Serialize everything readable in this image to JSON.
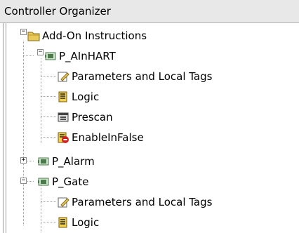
{
  "window": {
    "title": "Controller Organizer"
  },
  "tree": {
    "root": {
      "label": "Add-On Instructions",
      "icon": "folder-icon",
      "expanded": true
    },
    "nodes": [
      {
        "label": "P_AInHART",
        "icon": "add-on-instruction-icon",
        "expanded": true,
        "children": [
          {
            "label": "Parameters and Local Tags",
            "icon": "parameters-icon"
          },
          {
            "label": "Logic",
            "icon": "logic-routine-icon"
          },
          {
            "label": "Prescan",
            "icon": "prescan-routine-icon"
          },
          {
            "label": "EnableInFalse",
            "icon": "enable-in-false-icon"
          }
        ]
      },
      {
        "label": "P_Alarm",
        "icon": "add-on-instruction-icon",
        "expanded": false,
        "children": []
      },
      {
        "label": "P_Gate",
        "icon": "add-on-instruction-icon",
        "expanded": true,
        "children": [
          {
            "label": "Parameters and Local Tags",
            "icon": "parameters-icon"
          },
          {
            "label": "Logic",
            "icon": "logic-routine-icon"
          }
        ]
      }
    ]
  },
  "colors": {
    "titlebar_bg": "#e8e8e8",
    "folder": "#e8c95a",
    "aoi_icon": "#4a7a4a",
    "routine_red": "#d02020"
  }
}
